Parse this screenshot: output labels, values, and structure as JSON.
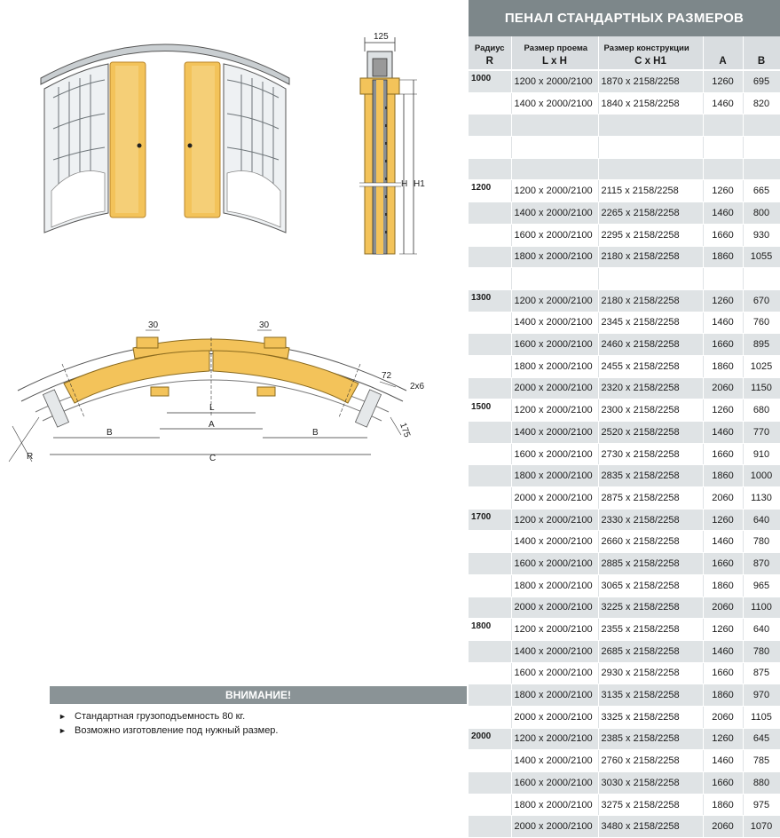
{
  "table": {
    "title": "ПЕНАЛ СТАНДАРТНЫХ РАЗМЕРОВ",
    "headers": {
      "radius": "Радиус",
      "radius_sym": "R",
      "opening": "Размер проема",
      "opening_sym": "L x H",
      "construction": "Размер конструкции",
      "construction_sym": "C x H1",
      "a": "A",
      "b": "B"
    },
    "groups": [
      {
        "radius": "1000",
        "rows": [
          [
            "1200 x 2000/2100",
            "1870 x 2158/2258",
            "1260",
            "695"
          ],
          [
            "1400 x 2000/2100",
            "1840 x 2158/2258",
            "1460",
            "820"
          ],
          [
            "",
            "",
            "",
            ""
          ],
          [
            "",
            "",
            "",
            ""
          ],
          [
            "",
            "",
            "",
            ""
          ]
        ]
      },
      {
        "radius": "1200",
        "rows": [
          [
            "1200 x 2000/2100",
            "2115 x 2158/2258",
            "1260",
            "665"
          ],
          [
            "1400 x 2000/2100",
            "2265 x 2158/2258",
            "1460",
            "800"
          ],
          [
            "1600 x 2000/2100",
            "2295 x 2158/2258",
            "1660",
            "930"
          ],
          [
            "1800 x 2000/2100",
            "2180 x 2158/2258",
            "1860",
            "1055"
          ],
          [
            "",
            "",
            "",
            ""
          ]
        ]
      },
      {
        "radius": "1300",
        "rows": [
          [
            "1200 x 2000/2100",
            "2180 x 2158/2258",
            "1260",
            "670"
          ],
          [
            "1400 x 2000/2100",
            "2345 x 2158/2258",
            "1460",
            "760"
          ],
          [
            "1600 x 2000/2100",
            "2460 x 2158/2258",
            "1660",
            "895"
          ],
          [
            "1800 x 2000/2100",
            "2455 x 2158/2258",
            "1860",
            "1025"
          ],
          [
            "2000 x 2000/2100",
            "2320 x 2158/2258",
            "2060",
            "1150"
          ]
        ]
      },
      {
        "radius": "1500",
        "rows": [
          [
            "1200 x 2000/2100",
            "2300 x 2158/2258",
            "1260",
            "680"
          ],
          [
            "1400 x 2000/2100",
            "2520 x 2158/2258",
            "1460",
            "770"
          ],
          [
            "1600 x 2000/2100",
            "2730 x 2158/2258",
            "1660",
            "910"
          ],
          [
            "1800 x 2000/2100",
            "2835 x 2158/2258",
            "1860",
            "1000"
          ],
          [
            "2000 x 2000/2100",
            "2875 x 2158/2258",
            "2060",
            "1130"
          ]
        ]
      },
      {
        "radius": "1700",
        "rows": [
          [
            "1200 x 2000/2100",
            "2330 x 2158/2258",
            "1260",
            "640"
          ],
          [
            "1400 x 2000/2100",
            "2660 x 2158/2258",
            "1460",
            "780"
          ],
          [
            "1600 x 2000/2100",
            "2885 x 2158/2258",
            "1660",
            "870"
          ],
          [
            "1800 x 2000/2100",
            "3065 x 2158/2258",
            "1860",
            "965"
          ],
          [
            "2000 x 2000/2100",
            "3225 x 2158/2258",
            "2060",
            "1100"
          ]
        ]
      },
      {
        "radius": "1800",
        "rows": [
          [
            "1200 x 2000/2100",
            "2355 x 2158/2258",
            "1260",
            "640"
          ],
          [
            "1400 x 2000/2100",
            "2685 x 2158/2258",
            "1460",
            "780"
          ],
          [
            "1600 x 2000/2100",
            "2930 x 2158/2258",
            "1660",
            "875"
          ],
          [
            "1800 x 2000/2100",
            "3135 x 2158/2258",
            "1860",
            "970"
          ],
          [
            "2000 x 2000/2100",
            "3325 x 2158/2258",
            "2060",
            "1105"
          ]
        ]
      },
      {
        "radius": "2000",
        "rows": [
          [
            "1200 x 2000/2100",
            "2385 x 2158/2258",
            "1260",
            "645"
          ],
          [
            "1400 x 2000/2100",
            "2760 x 2158/2258",
            "1460",
            "785"
          ],
          [
            "1600 x 2000/2100",
            "3030 x 2158/2258",
            "1660",
            "880"
          ],
          [
            "1800 x 2000/2100",
            "3275 x 2158/2258",
            "1860",
            "975"
          ],
          [
            "2000 x 2000/2100",
            "3480 x 2158/2258",
            "2060",
            "1070"
          ]
        ]
      }
    ]
  },
  "notice": {
    "title": "ВНИМАНИЕ!",
    "items": [
      "Стандартная грузоподъемность 80 кг.",
      "Возможно изготовление под нужный размер."
    ]
  },
  "drawing_labels": {
    "width_125": "125",
    "h": "H",
    "h1": "H1",
    "d30_left": "30",
    "d30_right": "30",
    "d72": "72",
    "d2x6": "2x6",
    "d175": "175",
    "l": "L",
    "a": "A",
    "b_left": "B",
    "b_right": "B",
    "c": "C",
    "r": "R"
  },
  "colors": {
    "header_dark": "#7d878a",
    "header_light": "#d9dde0",
    "row_shade": "#dfe3e5",
    "wood": "#f3c35a"
  }
}
